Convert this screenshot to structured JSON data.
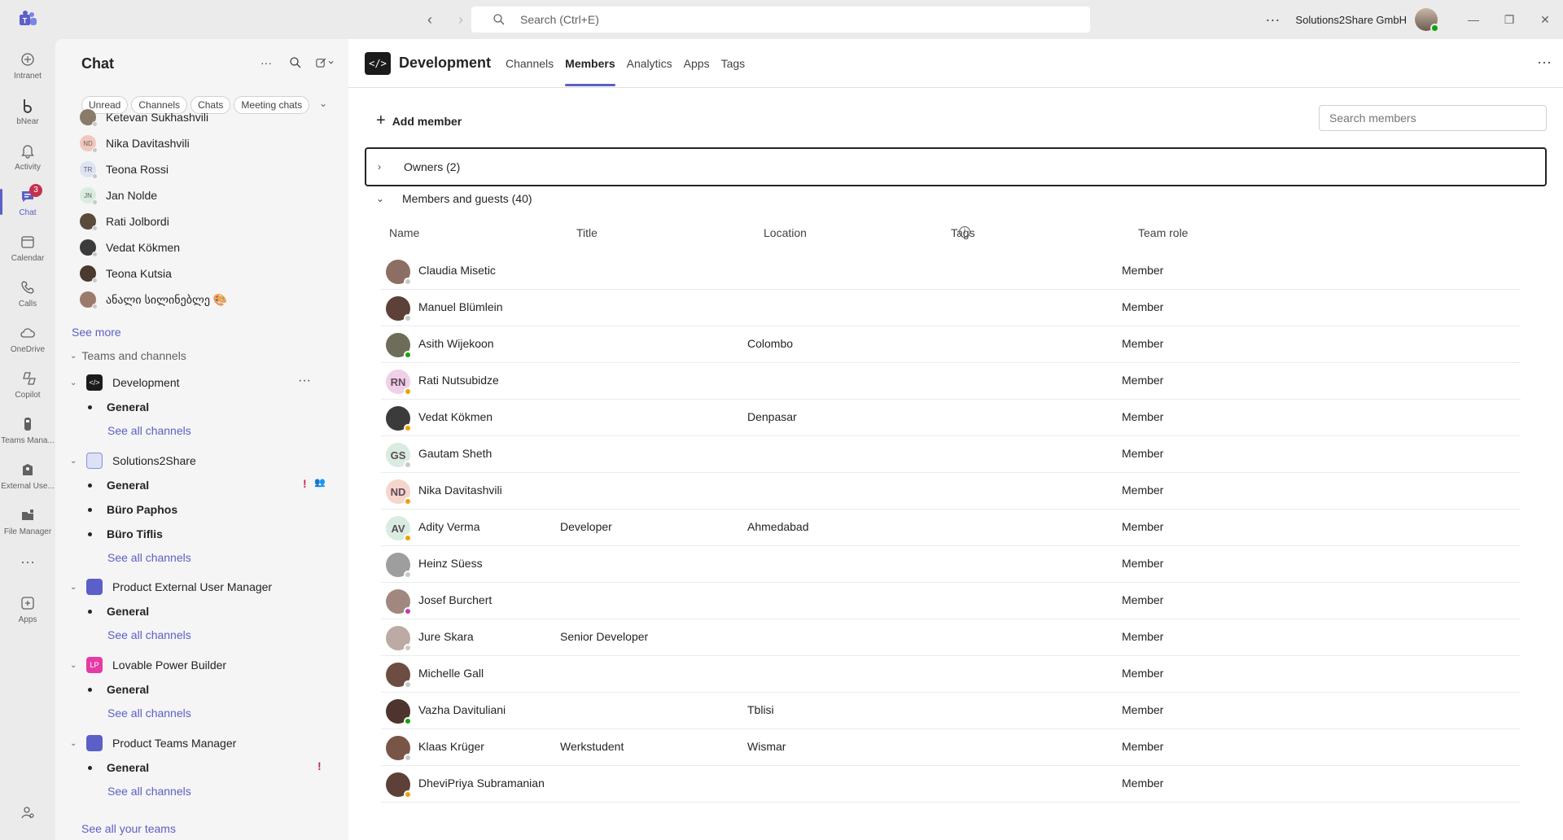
{
  "titlebar": {
    "search_placeholder": "Search (Ctrl+E)",
    "org_name": "Solutions2Share GmbH"
  },
  "rail": [
    {
      "label": "Intranet",
      "icon": "intranet-icon"
    },
    {
      "label": "bNear",
      "icon": "bnear-icon"
    },
    {
      "label": "Activity",
      "icon": "bell-icon"
    },
    {
      "label": "Chat",
      "icon": "chat-icon",
      "badge": "3"
    },
    {
      "label": "Calendar",
      "icon": "calendar-icon"
    },
    {
      "label": "Calls",
      "icon": "phone-icon"
    },
    {
      "label": "OneDrive",
      "icon": "cloud-icon"
    },
    {
      "label": "Copilot",
      "icon": "copilot-icon"
    },
    {
      "label": "Teams Mana...",
      "icon": "teams-manager-icon"
    },
    {
      "label": "External Use...",
      "icon": "external-user-icon"
    },
    {
      "label": "File Manager",
      "icon": "file-manager-icon"
    },
    {
      "label": "",
      "icon": "more-icon"
    },
    {
      "label": "Apps",
      "icon": "add-apps-icon"
    }
  ],
  "chat": {
    "title": "Chat",
    "filters": [
      "Unread",
      "Channels",
      "Chats",
      "Meeting chats"
    ],
    "recent": [
      {
        "name": "Ketevan Sukhashvili",
        "initials": "",
        "color": "#8a7a6a"
      },
      {
        "name": "Nika Davitashvili",
        "initials": "ND",
        "color": "#f3c7bd"
      },
      {
        "name": "Teona Rossi",
        "initials": "TR",
        "color": "#dde3f0"
      },
      {
        "name": "Jan Nolde",
        "initials": "JN",
        "color": "#d9ecdf"
      },
      {
        "name": "Rati Jolbordi",
        "initials": "",
        "color": "#5a4a3c"
      },
      {
        "name": "Vedat Kökmen",
        "initials": "",
        "color": "#3b3b3b"
      },
      {
        "name": "Teona Kutsia",
        "initials": "",
        "color": "#4a3a30"
      },
      {
        "name": "ანალი სილინებლე 🎨",
        "initials": "",
        "color": "#9b7a6a"
      }
    ],
    "see_more": "See more",
    "teams_section": "Teams and channels",
    "teams": [
      {
        "name": "Development",
        "channels": [
          "General"
        ],
        "see_all": "See all channels",
        "icon_color": "#1b1b1b",
        "icon_text": "</>"
      },
      {
        "name": "Solutions2Share",
        "channels": [
          "General",
          "Büro Paphos",
          "Büro Tiflis"
        ],
        "see_all": "See all channels",
        "icon_color": "#dde1f5",
        "icon_text": ""
      },
      {
        "name": "Product External User Manager",
        "channels": [
          "General"
        ],
        "see_all": "See all channels",
        "icon_color": "#5b5fc7",
        "icon_text": ""
      },
      {
        "name": "Lovable Power Builder",
        "channels": [
          "General"
        ],
        "see_all": "See all channels",
        "icon_color": "#e43ba6",
        "icon_text": "LP"
      },
      {
        "name": "Product Teams Manager",
        "channels": [
          "General"
        ],
        "see_all": "See all channels",
        "icon_color": "#5b5fc7",
        "icon_text": ""
      }
    ],
    "see_all_teams": "See all your teams"
  },
  "main": {
    "team_name": "Development",
    "tabs": [
      "Channels",
      "Members",
      "Analytics",
      "Apps",
      "Tags"
    ],
    "active_tab": "Members",
    "add_member": "Add member",
    "search_placeholder": "Search members",
    "owners_label": "Owners (2)",
    "members_label": "Members and guests (40)",
    "columns": {
      "name": "Name",
      "title": "Title",
      "location": "Location",
      "tags": "Tags",
      "role": "Team role"
    },
    "members": [
      {
        "name": "Claudia Misetic",
        "title": "",
        "location": "",
        "role": "Member",
        "initials": "",
        "avatar": "#8d6e63",
        "presence": "#c8c8c8"
      },
      {
        "name": "Manuel Blümlein",
        "title": "",
        "location": "",
        "role": "Member",
        "initials": "",
        "avatar": "#5d4037",
        "presence": "#c8c8c8"
      },
      {
        "name": "Asith Wijekoon",
        "title": "",
        "location": "Colombo",
        "role": "Member",
        "initials": "",
        "avatar": "#6d6d5a",
        "presence": "#13a10e"
      },
      {
        "name": "Rati Nutsubidze",
        "title": "",
        "location": "",
        "role": "Member",
        "initials": "RN",
        "avatar": "#f0d0e8",
        "presence": "#eaa300"
      },
      {
        "name": "Vedat Kökmen",
        "title": "",
        "location": "Denpasar",
        "role": "Member",
        "initials": "",
        "avatar": "#3b3b3b",
        "presence": "#eaa300"
      },
      {
        "name": "Gautam Sheth",
        "title": "",
        "location": "",
        "role": "Member",
        "initials": "GS",
        "avatar": "#d9ecdf",
        "presence": "#c8c8c8"
      },
      {
        "name": "Nika Davitashvili",
        "title": "",
        "location": "",
        "role": "Member",
        "initials": "ND",
        "avatar": "#f6d5cc",
        "presence": "#eaa300"
      },
      {
        "name": "Adity Verma",
        "title": "Developer",
        "location": "Ahmedabad",
        "role": "Member",
        "initials": "AV",
        "avatar": "#d9ecdf",
        "presence": "#eaa300"
      },
      {
        "name": "Heinz Süess",
        "title": "",
        "location": "",
        "role": "Member",
        "initials": "",
        "avatar": "#9e9e9e",
        "presence": "#c8c8c8"
      },
      {
        "name": "Josef Burchert",
        "title": "",
        "location": "",
        "role": "Member",
        "initials": "",
        "avatar": "#a1887f",
        "presence": "#c239b3"
      },
      {
        "name": "Jure Skara",
        "title": "Senior Developer",
        "location": "",
        "role": "Member",
        "initials": "",
        "avatar": "#bcaaa4",
        "presence": "#c8c8c8"
      },
      {
        "name": "Michelle Gall",
        "title": "",
        "location": "",
        "role": "Member",
        "initials": "",
        "avatar": "#6d4c41",
        "presence": "#c8c8c8"
      },
      {
        "name": "Vazha Davituliani",
        "title": "",
        "location": "Tblisi",
        "role": "Member",
        "initials": "",
        "avatar": "#4e342e",
        "presence": "#13a10e"
      },
      {
        "name": "Klaas Krüger",
        "title": "Werkstudent",
        "location": "Wismar",
        "role": "Member",
        "initials": "",
        "avatar": "#795548",
        "presence": "#c8c8c8"
      },
      {
        "name": "DheviPriya Subramanian",
        "title": "",
        "location": "",
        "role": "Member",
        "initials": "",
        "avatar": "#5d4037",
        "presence": "#eaa300"
      }
    ]
  }
}
